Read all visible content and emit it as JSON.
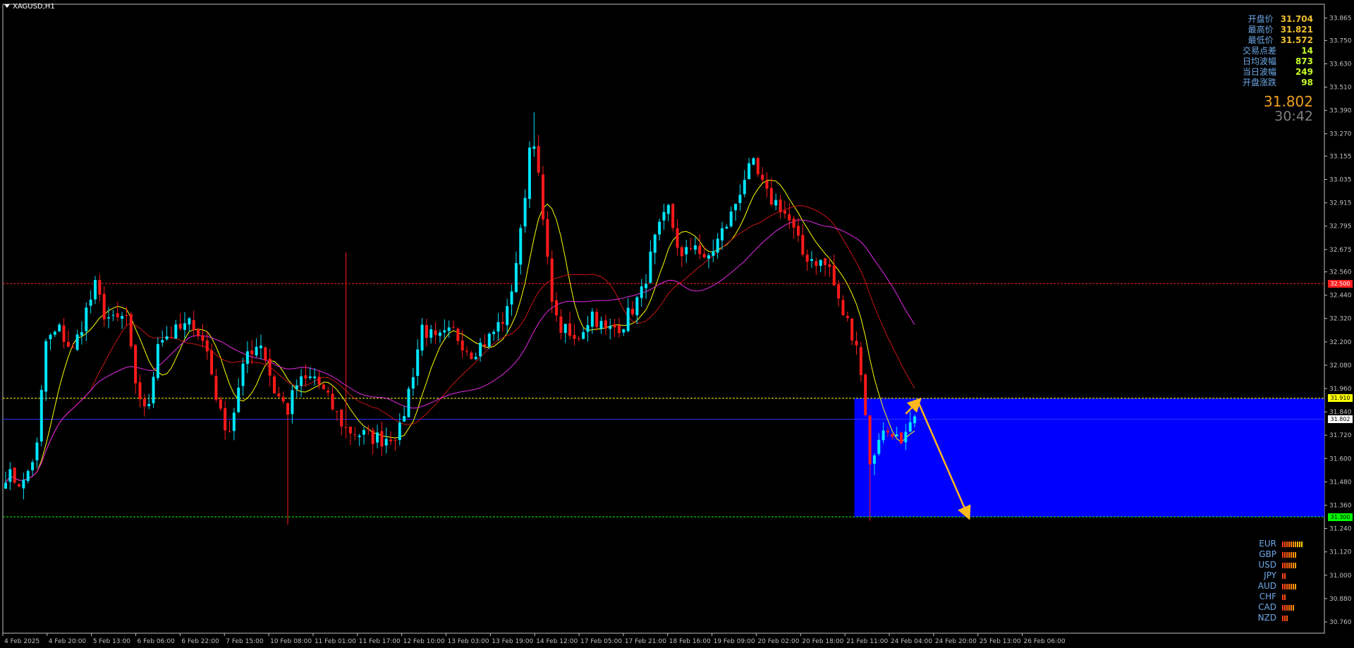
{
  "window": {
    "symbol_title": "XAGUSD,H1"
  },
  "stats": [
    {
      "label": "开盘价",
      "value": "31.704",
      "color": "orange"
    },
    {
      "label": "最高价",
      "value": "31.821",
      "color": "orange"
    },
    {
      "label": "最低价",
      "value": "31.572",
      "color": "orange"
    },
    {
      "label": "交易点差",
      "value": "14",
      "color": "green"
    },
    {
      "label": "日均波幅",
      "value": "873",
      "color": "green"
    },
    {
      "label": "当日波幅",
      "value": "249",
      "color": "green"
    },
    {
      "label": "开盘涨跌",
      "value": "98",
      "color": "green"
    }
  ],
  "current_price": "31.802",
  "bar_timer": "30:42",
  "price_tags": {
    "resistance_red": "32.500",
    "resistance_yellow": "31.910",
    "current": "31.802",
    "support_green": "31.300"
  },
  "currency_strength": [
    {
      "currency": "EUR",
      "level": 10,
      "max": 10
    },
    {
      "currency": "GBP",
      "level": 7,
      "max": 10
    },
    {
      "currency": "USD",
      "level": 7,
      "max": 10
    },
    {
      "currency": "JPY",
      "level": 2,
      "max": 10
    },
    {
      "currency": "AUD",
      "level": 7,
      "max": 10
    },
    {
      "currency": "CHF",
      "level": 2,
      "max": 10
    },
    {
      "currency": "CAD",
      "level": 6,
      "max": 10
    },
    {
      "currency": "NZD",
      "level": 3,
      "max": 10
    }
  ],
  "colors": {
    "background": "#000000",
    "bull_candle": "#00e5ff",
    "bear_candle": "#ff1a1a",
    "ma_fast": "#ffff00",
    "ma_mid": "#c81414",
    "ma_slow": "#e628e6",
    "zone": "#0000ff",
    "arrow": "#ffb81c",
    "resistance_red": "#ff2020",
    "resistance_yellow": "#ffff00",
    "support_green": "#00ff00",
    "current_line": "#3030ff"
  },
  "chart_data": {
    "type": "candlestick",
    "symbol": "XAGUSD",
    "timeframe": "H1",
    "y_ticks": [
      "33.865",
      "33.750",
      "33.630",
      "33.510",
      "33.390",
      "33.270",
      "33.155",
      "33.035",
      "32.915",
      "32.795",
      "32.675",
      "32.560",
      "32.440",
      "32.320",
      "32.200",
      "32.080",
      "31.960",
      "31.840",
      "31.720",
      "31.600",
      "31.480",
      "31.360",
      "31.240",
      "31.120",
      "31.000",
      "30.880",
      "30.760"
    ],
    "ylim": [
      30.76,
      33.865
    ],
    "x_ticks": [
      "4 Feb 2025",
      "4 Feb 20:00",
      "5 Feb 13:00",
      "6 Feb 06:00",
      "6 Feb 22:00",
      "7 Feb 15:00",
      "10 Feb 08:00",
      "11 Feb 01:00",
      "11 Feb 17:00",
      "12 Feb 10:00",
      "13 Feb 03:00",
      "13 Feb 19:00",
      "14 Feb 12:00",
      "17 Feb 05:00",
      "17 Feb 21:00",
      "18 Feb 16:00",
      "19 Feb 09:00",
      "20 Feb 02:00",
      "20 Feb 18:00",
      "21 Feb 11:00",
      "24 Feb 04:00",
      "24 Feb 20:00",
      "25 Feb 13:00",
      "26 Feb 06:00"
    ],
    "horizontal_levels": [
      {
        "price": 32.5,
        "style": "dashed",
        "color": "red"
      },
      {
        "price": 31.91,
        "style": "dashed",
        "color": "yellow"
      },
      {
        "price": 31.802,
        "style": "solid",
        "color": "blue"
      },
      {
        "price": 31.3,
        "style": "dashed",
        "color": "green"
      }
    ],
    "zone": {
      "from_bar": 190,
      "price_top": 31.91,
      "price_bottom": 31.3
    },
    "projection_arrows": [
      {
        "from_bar": 201,
        "from_price": 31.83,
        "to_bar": 204,
        "to_price": 31.9
      },
      {
        "from_bar": 204,
        "from_price": 31.88,
        "to_bar": 215,
        "to_price": 31.3
      }
    ],
    "close_path": [
      [
        0,
        31.52
      ],
      [
        4,
        31.47
      ],
      [
        7,
        31.66
      ],
      [
        9,
        32.2
      ],
      [
        12,
        32.26
      ],
      [
        15,
        32.15
      ],
      [
        18,
        32.36
      ],
      [
        20,
        32.48
      ],
      [
        22,
        32.35
      ],
      [
        24,
        32.3
      ],
      [
        27,
        32.33
      ],
      [
        29,
        31.95
      ],
      [
        32,
        31.85
      ],
      [
        34,
        32.22
      ],
      [
        38,
        32.25
      ],
      [
        42,
        32.3
      ],
      [
        45,
        32.15
      ],
      [
        48,
        31.82
      ],
      [
        50,
        31.75
      ],
      [
        54,
        32.15
      ],
      [
        57,
        32.2
      ],
      [
        60,
        31.95
      ],
      [
        63,
        31.85
      ],
      [
        65,
        31.98
      ],
      [
        69,
        32.02
      ],
      [
        72,
        31.9
      ],
      [
        76,
        31.75
      ],
      [
        80,
        31.72
      ],
      [
        84,
        31.7
      ],
      [
        88,
        31.74
      ],
      [
        91,
        32.05
      ],
      [
        93,
        32.28
      ],
      [
        96,
        32.2
      ],
      [
        100,
        32.25
      ],
      [
        104,
        32.15
      ],
      [
        108,
        32.22
      ],
      [
        112,
        32.35
      ],
      [
        115,
        32.75
      ],
      [
        117,
        33.2
      ],
      [
        118,
        33.25
      ],
      [
        121,
        32.6
      ],
      [
        123,
        32.3
      ],
      [
        127,
        32.2
      ],
      [
        131,
        32.35
      ],
      [
        134,
        32.25
      ],
      [
        138,
        32.3
      ],
      [
        142,
        32.45
      ],
      [
        145,
        32.72
      ],
      [
        148,
        32.88
      ],
      [
        151,
        32.62
      ],
      [
        154,
        32.72
      ],
      [
        156,
        32.6
      ],
      [
        159,
        32.72
      ],
      [
        162,
        32.85
      ],
      [
        165,
        33.05
      ],
      [
        167,
        33.1
      ],
      [
        170,
        32.95
      ],
      [
        173,
        32.9
      ],
      [
        175,
        32.82
      ],
      [
        178,
        32.65
      ],
      [
        181,
        32.62
      ],
      [
        184,
        32.58
      ],
      [
        186,
        32.4
      ],
      [
        188,
        32.3
      ],
      [
        190,
        32.2
      ],
      [
        192,
        31.85
      ],
      [
        193,
        31.55
      ],
      [
        195,
        31.72
      ],
      [
        198,
        31.75
      ],
      [
        200,
        31.65
      ],
      [
        203,
        31.8
      ]
    ]
  }
}
